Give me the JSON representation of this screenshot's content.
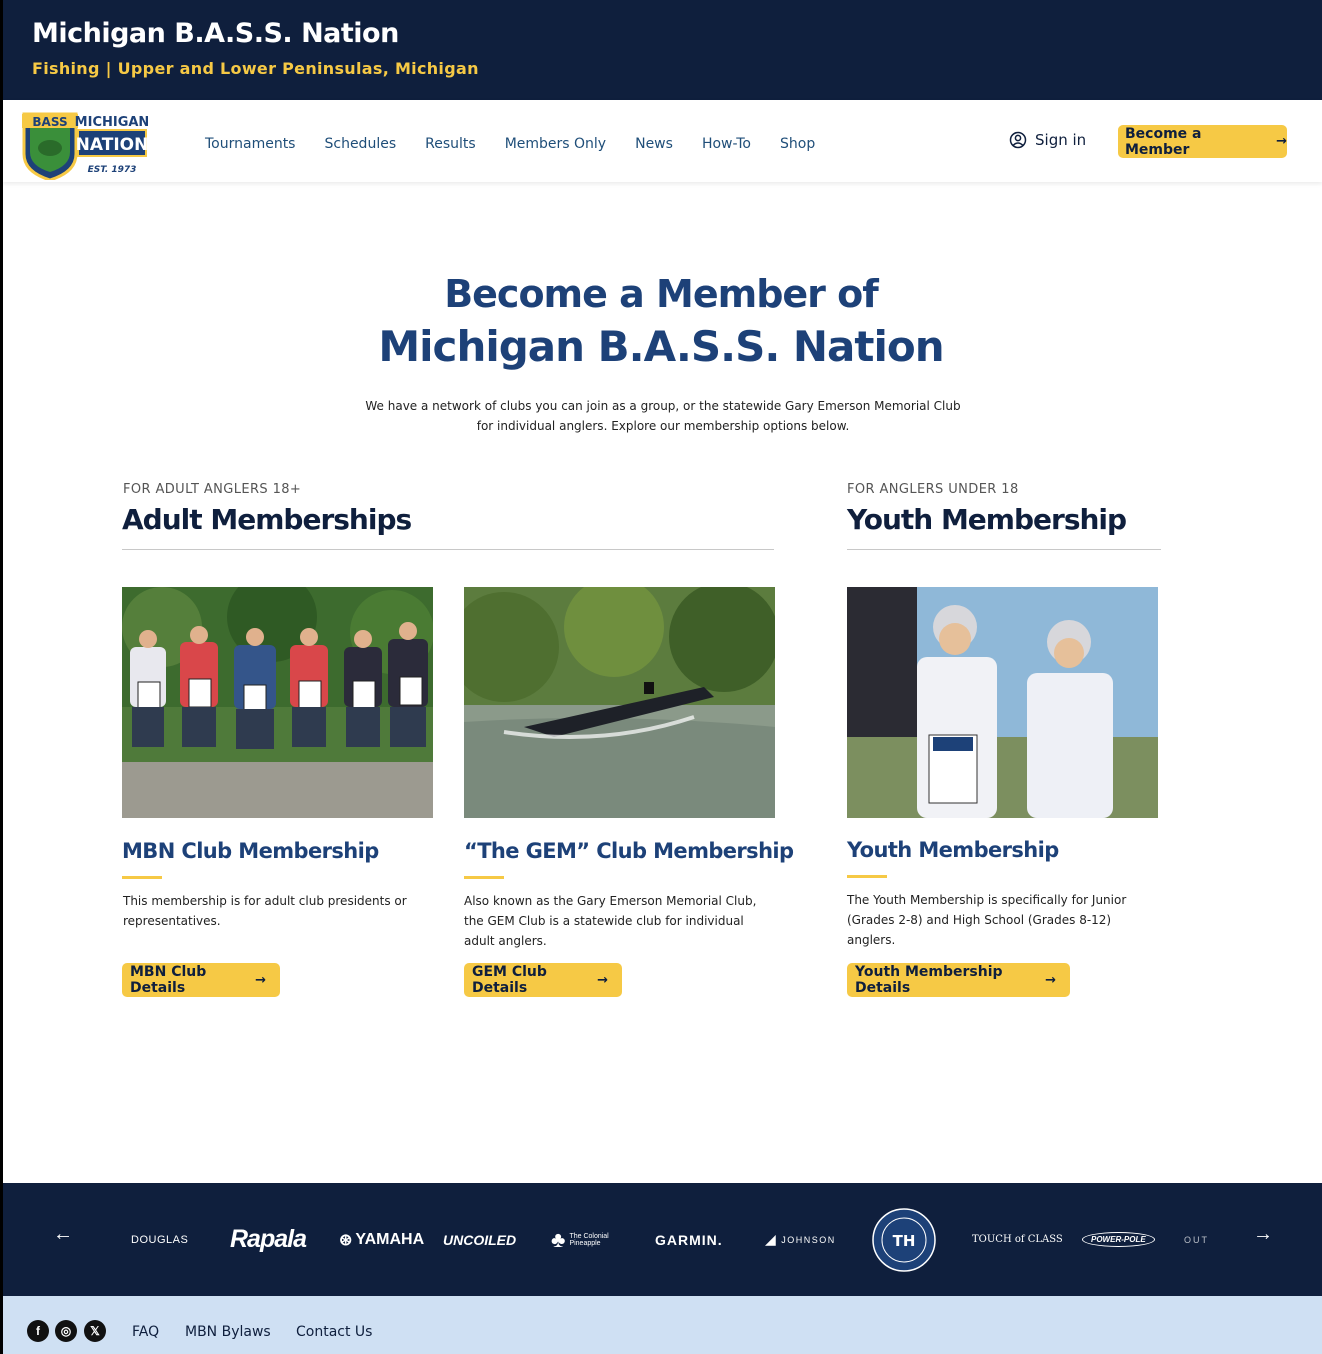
{
  "header": {
    "title": "Michigan B.A.S.S. Nation",
    "subtitle": "Fishing | Upper and Lower Peninsulas, Michigan"
  },
  "logo": {
    "top_text": "MICHIGAN",
    "main_text": "NATION",
    "bass_text": "BASS",
    "est_text": "EST. 1973"
  },
  "nav": {
    "items": [
      {
        "label": "Tournaments"
      },
      {
        "label": "Schedules"
      },
      {
        "label": "Results"
      },
      {
        "label": "Members Only"
      },
      {
        "label": "News"
      },
      {
        "label": "How-To"
      },
      {
        "label": "Shop"
      }
    ],
    "signin_label": "Sign in",
    "become_label": "Become a Member",
    "signin_icon": "user-circle-icon",
    "become_icon": "arrow-right-icon"
  },
  "hero": {
    "line1": "Become a Member of",
    "line2": "Michigan B.A.S.S. Nation",
    "description": "We have a network of clubs you can join as a group, or the statewide Gary Emerson Memorial Club for individual anglers. Explore our membership options below."
  },
  "adult_section": {
    "eyebrow": "FOR ADULT ANGLERS 18+",
    "title": "Adult Memberships",
    "cards": [
      {
        "title": "MBN Club Membership",
        "description": "This membership is for adult club presidents or representatives.",
        "button": "MBN Club Details"
      },
      {
        "title": "“The GEM” Club Membership",
        "description": "Also known as the Gary Emerson Memorial Club, the GEM Club is a statewide club for individual adult anglers.",
        "button": "GEM Club Details"
      }
    ]
  },
  "youth_section": {
    "eyebrow": "FOR ANGLERS UNDER 18",
    "title": "Youth Membership",
    "cards": [
      {
        "title": "Youth Membership",
        "description": "The Youth Membership is specifically for Junior (Grades 2-8) and High School (Grades 8-12) anglers.",
        "button": "Youth Membership Details"
      }
    ]
  },
  "sponsors": {
    "logos": [
      {
        "name": "Douglas",
        "text": "DOUGLAS"
      },
      {
        "name": "Rapala",
        "text": "Rapala"
      },
      {
        "name": "Yamaha",
        "text": "YAMAHA"
      },
      {
        "name": "Uncoiled",
        "text": "UNCOILED"
      },
      {
        "name": "The Colonial Pineapple",
        "text": "The Colonial Pineapple"
      },
      {
        "name": "Garmin",
        "text": "GARMIN."
      },
      {
        "name": "Johnson Outdoors",
        "text": "JOHNSON"
      },
      {
        "name": "T-H Marine",
        "text": "TH"
      },
      {
        "name": "Touch of Class Auto Wash",
        "text": "TOUCH of CLASS"
      },
      {
        "name": "Power-Pole",
        "text": "POWER-POLE"
      },
      {
        "name": "Outdoors",
        "text": "OUT"
      }
    ],
    "prev_icon": "arrow-left-icon",
    "next_icon": "arrow-right-icon"
  },
  "footer": {
    "social": [
      {
        "name": "facebook-icon",
        "glyph": "f"
      },
      {
        "name": "instagram-icon",
        "glyph": "◎"
      },
      {
        "name": "x-twitter-icon",
        "glyph": "𝕏"
      }
    ],
    "links": [
      {
        "label": "FAQ"
      },
      {
        "label": "MBN Bylaws"
      },
      {
        "label": "Contact Us"
      }
    ]
  },
  "colors": {
    "navy": "#0f1f3d",
    "brand_blue": "#1d4178",
    "accent_yellow": "#f6c945",
    "footer_bg": "#cfe0f3"
  }
}
